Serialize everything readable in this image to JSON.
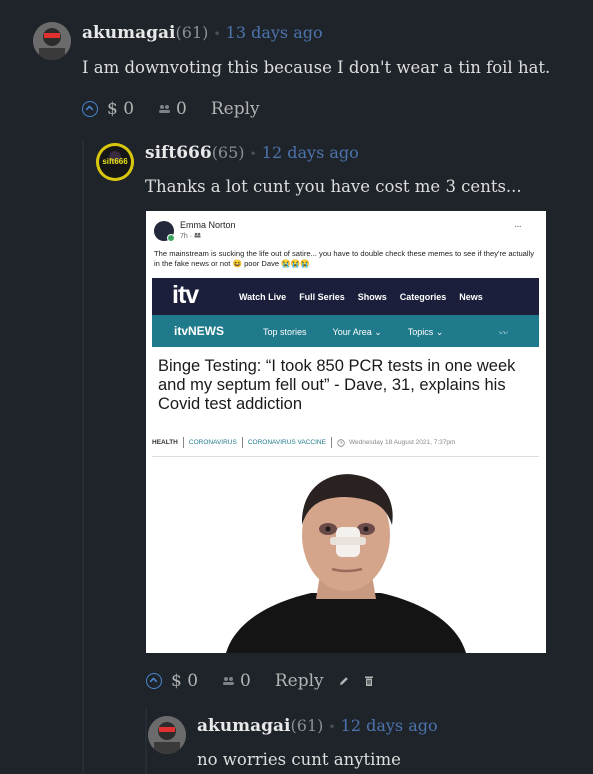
{
  "comments": [
    {
      "username": "akumagai",
      "rep": "(61)",
      "time": "13 days ago",
      "text": "I am downvoting this because I don't wear a tin foil hat.",
      "amount": "$ 0",
      "voters": "0",
      "reply": "Reply"
    },
    {
      "username": "sift666",
      "rep": "(65)",
      "avatar_text": "sift666",
      "time": "12 days ago",
      "text": "Thanks a lot cunt you have cost me 3 cents...",
      "amount": "$ 0",
      "voters": "0",
      "reply": "Reply"
    },
    {
      "username": "akumagai",
      "rep": "(61)",
      "time": "12 days ago",
      "text": "no worries cunt anytime"
    }
  ],
  "embed": {
    "poster": "Emma Norton",
    "poster_meta": "7h · ",
    "more": "···",
    "post_text": "The mainstream is sucking the life out of satire... you have to double check these memes to see if they're actually in the fake news or not 😆 poor Dave 😭😭😭",
    "itv_logo": "itv",
    "nav": [
      "Watch Live",
      "Full Series",
      "Shows",
      "Categories",
      "News"
    ],
    "news_logo": "itvNEWS",
    "subnav": [
      "Top stories",
      "Your Area ⌄",
      "Topics ⌄"
    ],
    "headline": "Binge Testing: “I took 850 PCR tests in one week and my septum fell out” - Dave, 31, explains his Covid test addiction",
    "tags": [
      "HEALTH",
      "CORONAVIRUS",
      "CORONAVIRUS VACCINE"
    ],
    "date": "Wednesday 18 August 2021, 7:37pm"
  },
  "colors": {
    "background": "#1f242b",
    "link": "#4c74ad",
    "upvote": "#4a86cf",
    "itv_bar": "#1b1f3b",
    "itv_news_bar": "#1f7a8c"
  }
}
